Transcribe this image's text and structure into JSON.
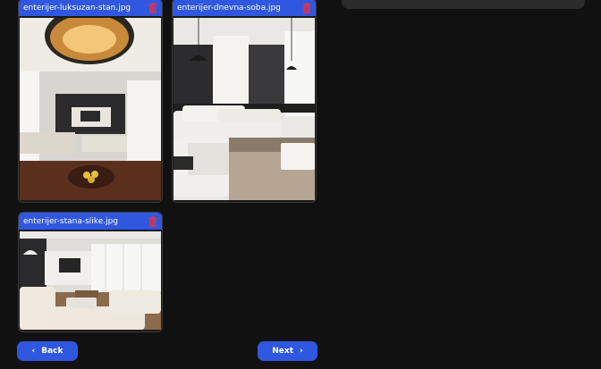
{
  "gallery": {
    "items": [
      {
        "filename": "enterijer-luksuzan-stan.jpg"
      },
      {
        "filename": "enterijer-dnevna-soba.jpg"
      },
      {
        "filename": "enterijer-stana-slike.jpg"
      }
    ],
    "delete_icon": "trash-icon"
  },
  "nav": {
    "back_label": "Back",
    "next_label": "Next",
    "back_icon": "chevron-left-icon",
    "next_icon": "chevron-right-icon"
  },
  "colors": {
    "accent": "#2f57e0",
    "delete": "#e0334a",
    "background": "#111111"
  }
}
